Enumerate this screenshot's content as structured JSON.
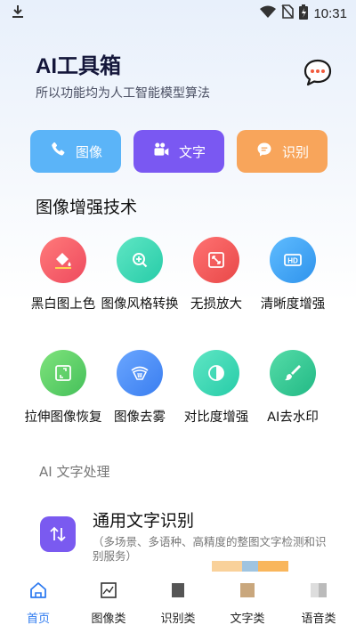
{
  "status_bar": {
    "time": "10:31",
    "icons": [
      "download-icon",
      "wifi-icon",
      "no-sim-icon",
      "battery-icon"
    ]
  },
  "header": {
    "title": "AI工具箱",
    "subtitle": "所以功能均为人工智能模型算法",
    "chat_icon": "chat-bubble-icon"
  },
  "quick_actions": [
    {
      "label": "图像",
      "icon": "phone-icon",
      "color": "#5bb4f8"
    },
    {
      "label": "文字",
      "icon": "video-camera-icon",
      "color": "#7a58f2"
    },
    {
      "label": "识别",
      "icon": "message-icon",
      "color": "#f8a55b"
    }
  ],
  "image_section": {
    "title": "图像增强技术",
    "tools": [
      {
        "label": "黑白图上色",
        "icon": "paint-bucket-icon",
        "color": "#f15a66"
      },
      {
        "label": "图像风格转换",
        "icon": "zoom-in-icon",
        "color": "#2fd6b4"
      },
      {
        "label": "无损放大",
        "icon": "expand-icon",
        "color": "#f25656"
      },
      {
        "label": "清晰度增强",
        "icon": "hd-icon",
        "color": "#3aa6f5"
      },
      {
        "label": "拉伸图像恢复",
        "icon": "crop-icon",
        "color": "#5ed06a"
      },
      {
        "label": "图像去雾",
        "icon": "defog-icon",
        "color": "#4b90f3"
      },
      {
        "label": "对比度增强",
        "icon": "contrast-icon",
        "color": "#2fd6b4"
      },
      {
        "label": "AI去水印",
        "icon": "brush-icon",
        "color": "#2fc98d"
      }
    ]
  },
  "text_section": {
    "title": "AI 文字处理",
    "feature": {
      "title": "通用文字识别",
      "description": "（多场景、多语种、高精度的整图文字检测和识别服务）",
      "icon": "sort-icon"
    }
  },
  "bottom_nav": [
    {
      "label": "首页",
      "icon": "home-icon",
      "active": true
    },
    {
      "label": "图像类",
      "icon": "image-chart-icon",
      "active": false
    },
    {
      "label": "识别类",
      "icon": "scan-icon",
      "active": false
    },
    {
      "label": "文字类",
      "icon": "text-icon",
      "active": false
    },
    {
      "label": "语音类",
      "icon": "voice-icon",
      "active": false
    }
  ]
}
